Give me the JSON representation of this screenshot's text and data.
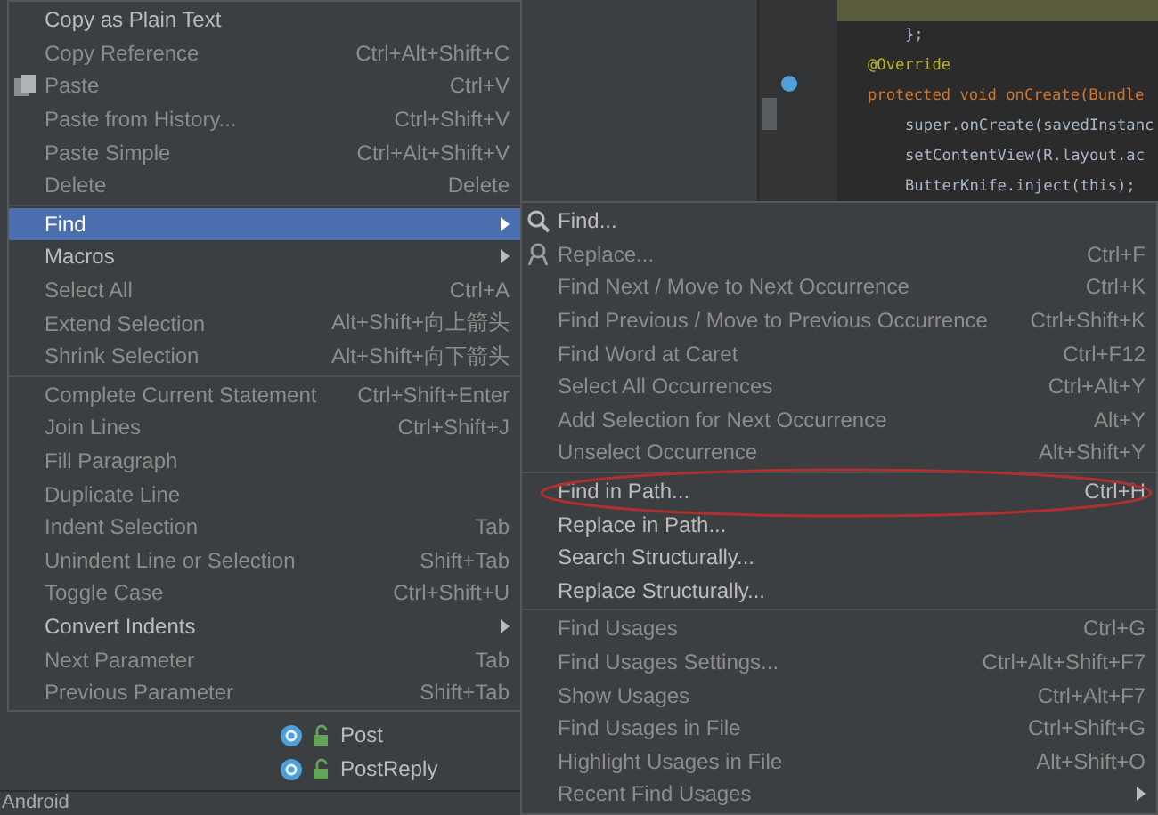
{
  "editor": {
    "code_lines": [
      {
        "children": [
          {
            "text": "};"
          }
        ]
      },
      {
        "text": "@Override",
        "kind": "annotation"
      },
      {
        "text": "protected void onCreate(Bundle",
        "kind": "declaration",
        "children": [
          {
            "text": "super.onCreate(savedInstanc"
          },
          {
            "text": "setContentView(R.layout.ac"
          },
          {
            "text": "ButterKnife.inject(this);"
          }
        ]
      }
    ]
  },
  "context_menu": {
    "items": [
      {
        "kind": "item",
        "label": "Copy as Plain Text",
        "enabled": true,
        "selected": false
      },
      {
        "kind": "item",
        "label": "Copy Reference",
        "shortcut": "Ctrl+Alt+Shift+C",
        "enabled": false,
        "selected": false
      },
      {
        "kind": "item",
        "label": "Paste",
        "shortcut": "Ctrl+V",
        "enabled": false,
        "selected": false
      },
      {
        "kind": "item",
        "label": "Paste from History...",
        "shortcut": "Ctrl+Shift+V",
        "enabled": false,
        "selected": false
      },
      {
        "kind": "item",
        "label": "Paste Simple",
        "shortcut": "Ctrl+Alt+Shift+V",
        "enabled": false,
        "selected": false
      },
      {
        "kind": "item",
        "label": "Delete",
        "shortcut": "Delete",
        "enabled": false,
        "selected": false
      },
      {
        "kind": "separator"
      },
      {
        "kind": "submenu",
        "label": "Find",
        "enabled": true,
        "selected": true
      },
      {
        "kind": "submenu",
        "label": "Macros",
        "enabled": true,
        "selected": false
      },
      {
        "kind": "item",
        "label": "Select All",
        "shortcut": "Ctrl+A",
        "enabled": false,
        "selected": false
      },
      {
        "kind": "item",
        "label": "Extend Selection",
        "shortcut": "Alt+Shift+向上箭头",
        "enabled": false,
        "selected": false
      },
      {
        "kind": "item",
        "label": "Shrink Selection",
        "shortcut": "Alt+Shift+向下箭头",
        "enabled": false,
        "selected": false
      },
      {
        "kind": "separator"
      },
      {
        "kind": "item",
        "label": "Complete Current Statement",
        "shortcut": "Ctrl+Shift+Enter",
        "enabled": false,
        "selected": false
      },
      {
        "kind": "item",
        "label": "Join Lines",
        "shortcut": "Ctrl+Shift+J",
        "enabled": false,
        "selected": false
      },
      {
        "kind": "item",
        "label": "Fill Paragraph",
        "enabled": false,
        "selected": false
      },
      {
        "kind": "item",
        "label": "Duplicate Line",
        "enabled": false,
        "selected": false
      },
      {
        "kind": "item",
        "label": "Indent Selection",
        "shortcut": "Tab",
        "enabled": false,
        "selected": false
      },
      {
        "kind": "item",
        "label": "Unindent Line or Selection",
        "shortcut": "Shift+Tab",
        "enabled": false,
        "selected": false
      },
      {
        "kind": "item",
        "label": "Toggle Case",
        "shortcut": "Ctrl+Shift+U",
        "enabled": false,
        "selected": false
      },
      {
        "kind": "submenu",
        "label": "Convert Indents",
        "enabled": true,
        "selected": false
      },
      {
        "kind": "item",
        "label": "Next Parameter",
        "shortcut": "Tab",
        "enabled": false,
        "selected": false
      },
      {
        "kind": "item",
        "label": "Previous Parameter",
        "shortcut": "Shift+Tab",
        "enabled": false,
        "selected": false
      }
    ]
  },
  "find_submenu": {
    "items": [
      {
        "kind": "item",
        "label": "Find...",
        "enabled": true,
        "selected": false
      },
      {
        "kind": "item",
        "label": "Replace...",
        "shortcut": "Ctrl+F",
        "enabled": false,
        "selected": false
      },
      {
        "kind": "item",
        "label": "Find Next / Move to Next Occurrence",
        "shortcut": "Ctrl+K",
        "enabled": false,
        "selected": false
      },
      {
        "kind": "item",
        "label": "Find Previous / Move to Previous Occurrence",
        "shortcut": "Ctrl+Shift+K",
        "enabled": false,
        "selected": false
      },
      {
        "kind": "item",
        "label": "Find Word at Caret",
        "shortcut": "Ctrl+F12",
        "enabled": false,
        "selected": false
      },
      {
        "kind": "item",
        "label": "Select All Occurrences",
        "shortcut": "Ctrl+Alt+Y",
        "enabled": false,
        "selected": false
      },
      {
        "kind": "item",
        "label": "Add Selection for Next Occurrence",
        "shortcut": "Alt+Y",
        "enabled": false,
        "selected": false
      },
      {
        "kind": "item",
        "label": "Unselect Occurrence",
        "shortcut": "Alt+Shift+Y",
        "enabled": false,
        "selected": false
      },
      {
        "kind": "separator"
      },
      {
        "kind": "item",
        "label": "Find in Path...",
        "shortcut": "Ctrl+H",
        "enabled": true,
        "selected": false,
        "circled": true
      },
      {
        "kind": "item",
        "label": "Replace in Path...",
        "enabled": true,
        "selected": false
      },
      {
        "kind": "item",
        "label": "Search Structurally...",
        "enabled": true,
        "selected": false
      },
      {
        "kind": "item",
        "label": "Replace Structurally...",
        "enabled": true,
        "selected": false
      },
      {
        "kind": "separator"
      },
      {
        "kind": "item",
        "label": "Find Usages",
        "shortcut": "Ctrl+G",
        "enabled": false,
        "selected": false
      },
      {
        "kind": "item",
        "label": "Find Usages Settings...",
        "shortcut": "Ctrl+Alt+Shift+F7",
        "enabled": false,
        "selected": false
      },
      {
        "kind": "item",
        "label": "Show Usages",
        "shortcut": "Ctrl+Alt+F7",
        "enabled": false,
        "selected": false
      },
      {
        "kind": "item",
        "label": "Find Usages in File",
        "shortcut": "Ctrl+Shift+G",
        "enabled": false,
        "selected": false
      },
      {
        "kind": "item",
        "label": "Highlight Usages in File",
        "shortcut": "Alt+Shift+O",
        "enabled": false,
        "selected": false
      },
      {
        "kind": "submenu",
        "label": "Recent Find Usages",
        "enabled": false,
        "selected": false
      }
    ]
  },
  "project_tree": {
    "items": [
      {
        "label": "Post"
      },
      {
        "label": "PostReply"
      }
    ]
  },
  "status_bar": {
    "text": "Android"
  }
}
